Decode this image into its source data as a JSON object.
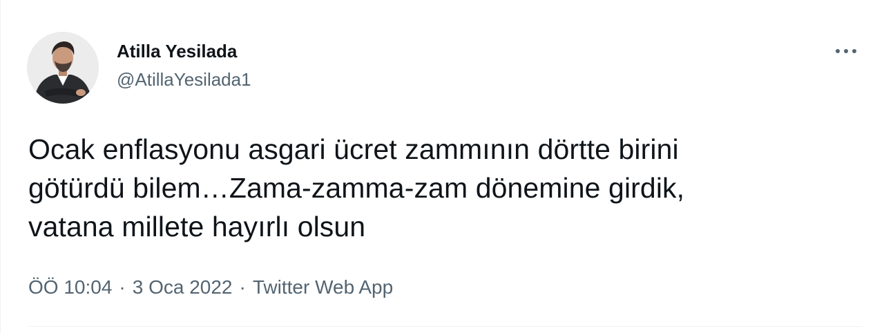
{
  "author": {
    "display_name": "Atilla Yesilada",
    "handle": "@AtillaYesilada1"
  },
  "tweet": {
    "text": "Ocak enflasyonu asgari ücret zammının dörtte birini\ngötürdü bilem…Zama-zamma-zam dönemine girdik,\nvatana millete hayırlı olsun",
    "time": "ÖÖ 10:04",
    "date": "3 Oca 2022",
    "source": "Twitter Web App",
    "separator": "·"
  },
  "icons": {
    "more": "more-horizontal-icon",
    "avatar": "profile-photo"
  },
  "colors": {
    "primary_text": "#0f1419",
    "secondary_text": "#536471",
    "divider": "#eff3f4"
  }
}
